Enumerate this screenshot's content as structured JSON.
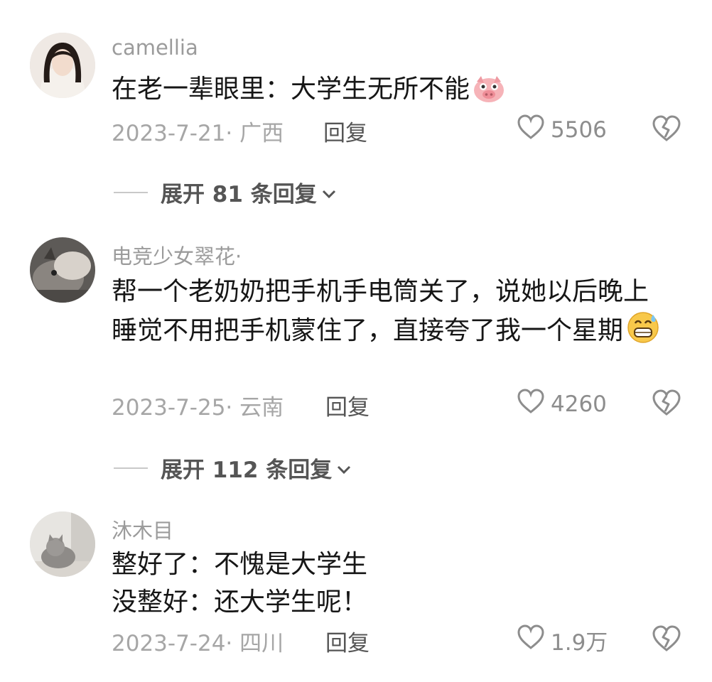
{
  "comments": [
    {
      "username": "camellia",
      "text": "在老一辈眼里：大学生无所不能",
      "emoji": "pig-face-icon",
      "date_location": "2023-7-21· 广西",
      "reply_label": "回复",
      "likes": "5506",
      "expand_label": "展开 81 条回复"
    },
    {
      "username": "电竞少女翠花·",
      "text": "帮一个老奶奶把手机手电筒关了，说她以后晚上睡觉不用把手机蒙住了，直接夸了我一个星期",
      "emoji": "grinning-sweat-icon",
      "date_location": "2023-7-25· 云南",
      "reply_label": "回复",
      "likes": "4260",
      "expand_label": "展开 112 条回复"
    },
    {
      "username": "沐木目",
      "text_line1": "整好了：不愧是大学生",
      "text_line2": "没整好：还大学生呢！",
      "date_location": "2023-7-24· 四川",
      "reply_label": "回复",
      "likes": "1.9万"
    }
  ],
  "colors": {
    "meta": "#a6a6a6",
    "text": "#161616",
    "username": "#9b9b9b"
  }
}
